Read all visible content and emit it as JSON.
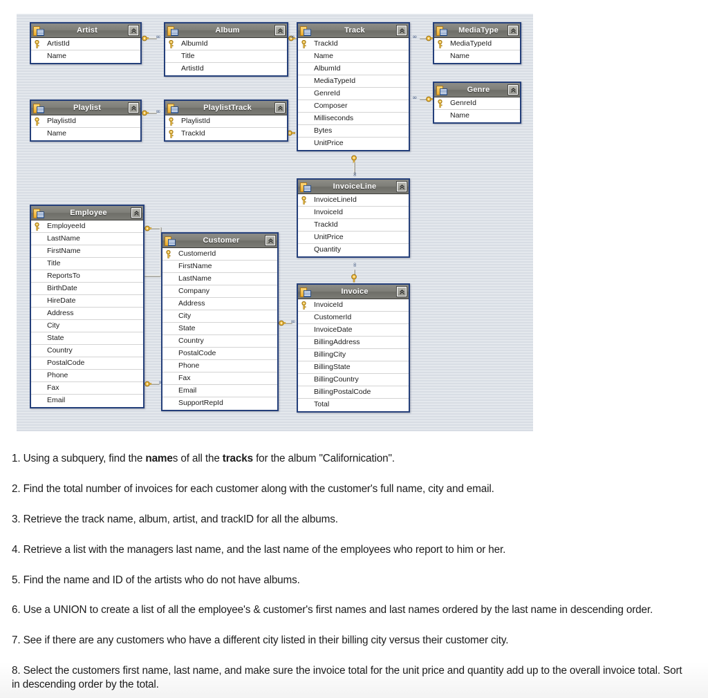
{
  "diagram": {
    "title": "Chinook database schema diagram",
    "canvas_background": "#dfe4e9",
    "entity_border_color": "#243f7a",
    "entity_header_color": "#7b7b75",
    "tables": [
      {
        "id": "artist",
        "name": "Artist",
        "fields": [
          {
            "name": "ArtistId",
            "key": true
          },
          {
            "name": "Name",
            "key": false
          }
        ]
      },
      {
        "id": "album",
        "name": "Album",
        "fields": [
          {
            "name": "AlbumId",
            "key": true
          },
          {
            "name": "Title",
            "key": false
          },
          {
            "name": "ArtistId",
            "key": false
          }
        ]
      },
      {
        "id": "track",
        "name": "Track",
        "fields": [
          {
            "name": "TrackId",
            "key": true
          },
          {
            "name": "Name",
            "key": false
          },
          {
            "name": "AlbumId",
            "key": false
          },
          {
            "name": "MediaTypeId",
            "key": false
          },
          {
            "name": "GenreId",
            "key": false
          },
          {
            "name": "Composer",
            "key": false
          },
          {
            "name": "Milliseconds",
            "key": false
          },
          {
            "name": "Bytes",
            "key": false
          },
          {
            "name": "UnitPrice",
            "key": false
          }
        ]
      },
      {
        "id": "mediatype",
        "name": "MediaType",
        "fields": [
          {
            "name": "MediaTypeId",
            "key": true
          },
          {
            "name": "Name",
            "key": false
          }
        ]
      },
      {
        "id": "genre",
        "name": "Genre",
        "fields": [
          {
            "name": "GenreId",
            "key": true
          },
          {
            "name": "Name",
            "key": false
          }
        ]
      },
      {
        "id": "playlist",
        "name": "Playlist",
        "fields": [
          {
            "name": "PlaylistId",
            "key": true
          },
          {
            "name": "Name",
            "key": false
          }
        ]
      },
      {
        "id": "playlisttrack",
        "name": "PlaylistTrack",
        "fields": [
          {
            "name": "PlaylistId",
            "key": true
          },
          {
            "name": "TrackId",
            "key": true
          }
        ]
      },
      {
        "id": "invoiceline",
        "name": "InvoiceLine",
        "fields": [
          {
            "name": "InvoiceLineId",
            "key": true
          },
          {
            "name": "InvoiceId",
            "key": false
          },
          {
            "name": "TrackId",
            "key": false
          },
          {
            "name": "UnitPrice",
            "key": false
          },
          {
            "name": "Quantity",
            "key": false
          }
        ]
      },
      {
        "id": "invoice",
        "name": "Invoice",
        "fields": [
          {
            "name": "InvoiceId",
            "key": true
          },
          {
            "name": "CustomerId",
            "key": false
          },
          {
            "name": "InvoiceDate",
            "key": false
          },
          {
            "name": "BillingAddress",
            "key": false
          },
          {
            "name": "BillingCity",
            "key": false
          },
          {
            "name": "BillingState",
            "key": false
          },
          {
            "name": "BillingCountry",
            "key": false
          },
          {
            "name": "BillingPostalCode",
            "key": false
          },
          {
            "name": "Total",
            "key": false
          }
        ]
      },
      {
        "id": "customer",
        "name": "Customer",
        "fields": [
          {
            "name": "CustomerId",
            "key": true
          },
          {
            "name": "FirstName",
            "key": false
          },
          {
            "name": "LastName",
            "key": false
          },
          {
            "name": "Company",
            "key": false
          },
          {
            "name": "Address",
            "key": false
          },
          {
            "name": "City",
            "key": false
          },
          {
            "name": "State",
            "key": false
          },
          {
            "name": "Country",
            "key": false
          },
          {
            "name": "PostalCode",
            "key": false
          },
          {
            "name": "Phone",
            "key": false
          },
          {
            "name": "Fax",
            "key": false
          },
          {
            "name": "Email",
            "key": false
          },
          {
            "name": "SupportRepId",
            "key": false
          }
        ]
      },
      {
        "id": "employee",
        "name": "Employee",
        "fields": [
          {
            "name": "EmployeeId",
            "key": true
          },
          {
            "name": "LastName",
            "key": false
          },
          {
            "name": "FirstName",
            "key": false
          },
          {
            "name": "Title",
            "key": false
          },
          {
            "name": "ReportsTo",
            "key": false
          },
          {
            "name": "BirthDate",
            "key": false
          },
          {
            "name": "HireDate",
            "key": false
          },
          {
            "name": "Address",
            "key": false
          },
          {
            "name": "City",
            "key": false
          },
          {
            "name": "State",
            "key": false
          },
          {
            "name": "Country",
            "key": false
          },
          {
            "name": "PostalCode",
            "key": false
          },
          {
            "name": "Phone",
            "key": false
          },
          {
            "name": "Fax",
            "key": false
          },
          {
            "name": "Email",
            "key": false
          }
        ]
      }
    ],
    "relationships": [
      {
        "from": "Artist.ArtistId",
        "to": "Album.ArtistId"
      },
      {
        "from": "Album.AlbumId",
        "to": "Track.AlbumId"
      },
      {
        "from": "MediaType.MediaTypeId",
        "to": "Track.MediaTypeId"
      },
      {
        "from": "Genre.GenreId",
        "to": "Track.GenreId"
      },
      {
        "from": "Playlist.PlaylistId",
        "to": "PlaylistTrack.PlaylistId"
      },
      {
        "from": "Track.TrackId",
        "to": "PlaylistTrack.TrackId"
      },
      {
        "from": "Track.TrackId",
        "to": "InvoiceLine.TrackId"
      },
      {
        "from": "Invoice.InvoiceId",
        "to": "InvoiceLine.InvoiceId"
      },
      {
        "from": "Customer.CustomerId",
        "to": "Invoice.CustomerId"
      },
      {
        "from": "Employee.EmployeeId",
        "to": "Employee.ReportsTo"
      },
      {
        "from": "Employee.EmployeeId",
        "to": "Customer.SupportRepId"
      }
    ]
  },
  "questions": [
    {
      "number": "1.",
      "parts": [
        {
          "text": "Using a subquery, find the ",
          "bold": false
        },
        {
          "text": "name",
          "bold": true
        },
        {
          "text": "s of all the ",
          "bold": false
        },
        {
          "text": "tracks",
          "bold": true
        },
        {
          "text": " for the album \"Californication\".",
          "bold": false
        }
      ]
    },
    {
      "number": "2.",
      "parts": [
        {
          "text": "Find the total number of invoices for each customer along with the customer's full name, city and email.",
          "bold": false
        }
      ]
    },
    {
      "number": "3.",
      "parts": [
        {
          "text": "Retrieve the track name, album, artist, and trackID for all the albums.",
          "bold": false
        }
      ]
    },
    {
      "number": "4.",
      "parts": [
        {
          "text": "Retrieve a list with the managers last name, and the last name of the employees who report to him or her.",
          "bold": false
        }
      ]
    },
    {
      "number": "5.",
      "parts": [
        {
          "text": "Find the name and ID of the artists who do not have albums.",
          "bold": false
        }
      ]
    },
    {
      "number": "6.",
      "parts": [
        {
          "text": "Use a UNION to create a list of all the employee's & customer's first names and last names ordered by the last name in descending order.",
          "bold": false
        }
      ]
    },
    {
      "number": "7.",
      "parts": [
        {
          "text": "See if there are any customers who have a different city listed in their billing city versus their customer city.",
          "bold": false
        }
      ]
    },
    {
      "number": "8.",
      "parts": [
        {
          "text": "Select the customers first name, last name, and make sure the invoice total for the unit price and quantity add up to the overall invoice total. Sort in descending order by the total.",
          "bold": false
        }
      ]
    }
  ]
}
